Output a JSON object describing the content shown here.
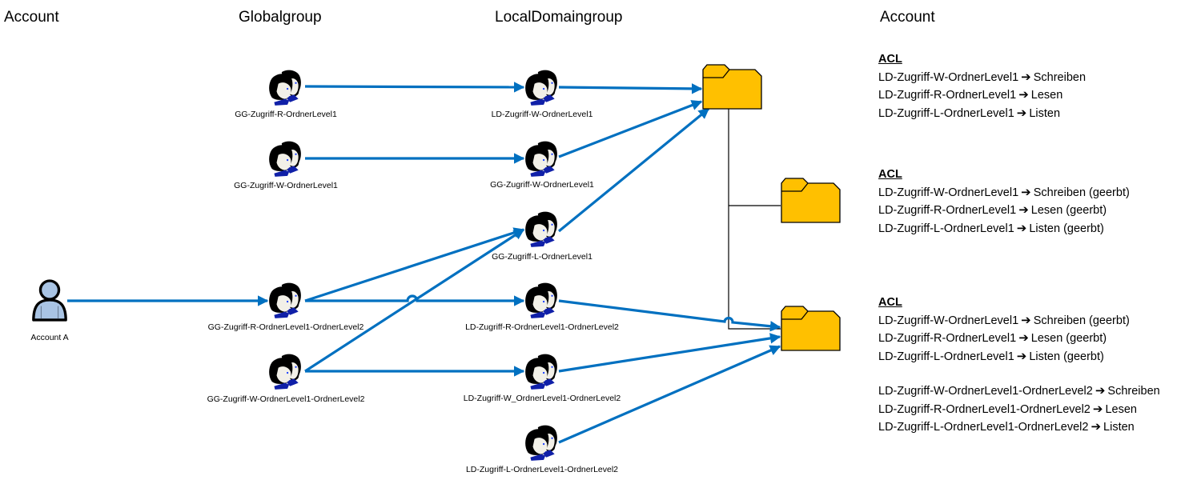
{
  "column_headers": {
    "account": "Account",
    "globalgroup": "Globalgroup",
    "localdomaingroup": "LocalDomaingroup",
    "account_right": "Account"
  },
  "colors": {
    "arrow": "#0070c0",
    "folder_fill": "#ffc000",
    "folder_stroke": "#000000",
    "connector": "#000000",
    "user_fill": "#a9c4e4"
  },
  "account": {
    "label": "Account A",
    "icon": "user-icon"
  },
  "global_groups": [
    {
      "id": "gg1",
      "label": "GG-Zugriff-R-OrdnerLevel1",
      "icon": "group-icon"
    },
    {
      "id": "gg2",
      "label": "GG-Zugriff-W-OrdnerLevel1",
      "icon": "group-icon"
    },
    {
      "id": "gg3",
      "label": "GG-Zugriff-R-OrdnerLevel1-OrdnerLevel2",
      "icon": "group-icon"
    },
    {
      "id": "gg4",
      "label": "GG-Zugriff-W-OrdnerLevel1-OrdnerLevel2",
      "icon": "group-icon"
    }
  ],
  "local_domain_groups": [
    {
      "id": "ld1",
      "label": "LD-Zugriff-W-OrdnerLevel1",
      "icon": "group-icon"
    },
    {
      "id": "ld2",
      "label": "GG-Zugriff-W-OrdnerLevel1",
      "icon": "group-icon"
    },
    {
      "id": "ld3",
      "label": "GG-Zugriff-L-OrdnerLevel1",
      "icon": "group-icon"
    },
    {
      "id": "ld4",
      "label": "LD-Zugriff-R-OrdnerLevel1-OrdnerLevel2",
      "icon": "group-icon"
    },
    {
      "id": "ld5",
      "label": "LD-Zugriff-W_OrdnerLevel1-OrdnerLevel2",
      "icon": "group-icon"
    },
    {
      "id": "ld6",
      "label": "LD-Zugriff-L-OrdnerLevel1-OrdnerLevel2",
      "icon": "group-icon"
    }
  ],
  "folders": [
    {
      "id": "f1",
      "icon": "folder-icon"
    },
    {
      "id": "f2",
      "icon": "folder-icon"
    },
    {
      "id": "f3",
      "icon": "folder-icon"
    }
  ],
  "edges": [
    {
      "from": "account",
      "to": "gg3"
    },
    {
      "from": "gg1",
      "to": "ld1"
    },
    {
      "from": "gg2",
      "to": "ld2"
    },
    {
      "from": "gg3",
      "to": "ld3"
    },
    {
      "from": "gg3",
      "to": "ld4"
    },
    {
      "from": "gg4",
      "to": "ld3"
    },
    {
      "from": "gg4",
      "to": "ld5"
    },
    {
      "from": "ld1",
      "to": "f1"
    },
    {
      "from": "ld2",
      "to": "f1"
    },
    {
      "from": "ld3",
      "to": "f1"
    },
    {
      "from": "ld4",
      "to": "f3"
    },
    {
      "from": "ld5",
      "to": "f3"
    },
    {
      "from": "ld6",
      "to": "f3"
    }
  ],
  "folder_tree": {
    "parent": "f1",
    "children": [
      "f2",
      "f3"
    ]
  },
  "acl_blocks": [
    {
      "title": "ACL",
      "entries": [
        {
          "group": "LD-Zugriff-W-OrdnerLevel1",
          "right": "Schreiben"
        },
        {
          "group": "LD-Zugriff-R-OrdnerLevel1",
          "right": "Lesen"
        },
        {
          "group": "LD-Zugriff-L-OrdnerLevel1",
          "right": "Listen"
        }
      ]
    },
    {
      "title": "ACL",
      "entries": [
        {
          "group": "LD-Zugriff-W-OrdnerLevel1",
          "right": "Schreiben (geerbt)"
        },
        {
          "group": "LD-Zugriff-R-OrdnerLevel1",
          "right": "Lesen (geerbt)"
        },
        {
          "group": "LD-Zugriff-L-OrdnerLevel1",
          "right": "Listen (geerbt)"
        }
      ]
    },
    {
      "title": "ACL",
      "entries": [
        {
          "group": "LD-Zugriff-W-OrdnerLevel1",
          "right": "Schreiben (geerbt)"
        },
        {
          "group": "LD-Zugriff-R-OrdnerLevel1",
          "right": "Lesen (geerbt)"
        },
        {
          "group": "LD-Zugriff-L-OrdnerLevel1",
          "right": "Listen (geerbt)"
        }
      ],
      "extra_entries": [
        {
          "group": "LD-Zugriff-W-OrdnerLevel1-OrdnerLevel2",
          "right": "Schreiben"
        },
        {
          "group": "LD-Zugriff-R-OrdnerLevel1-OrdnerLevel2",
          "right": "Lesen"
        },
        {
          "group": "LD-Zugriff-L-OrdnerLevel1-OrdnerLevel2",
          "right": "Listen"
        }
      ]
    }
  ],
  "acl_arrow_glyph": "➔"
}
